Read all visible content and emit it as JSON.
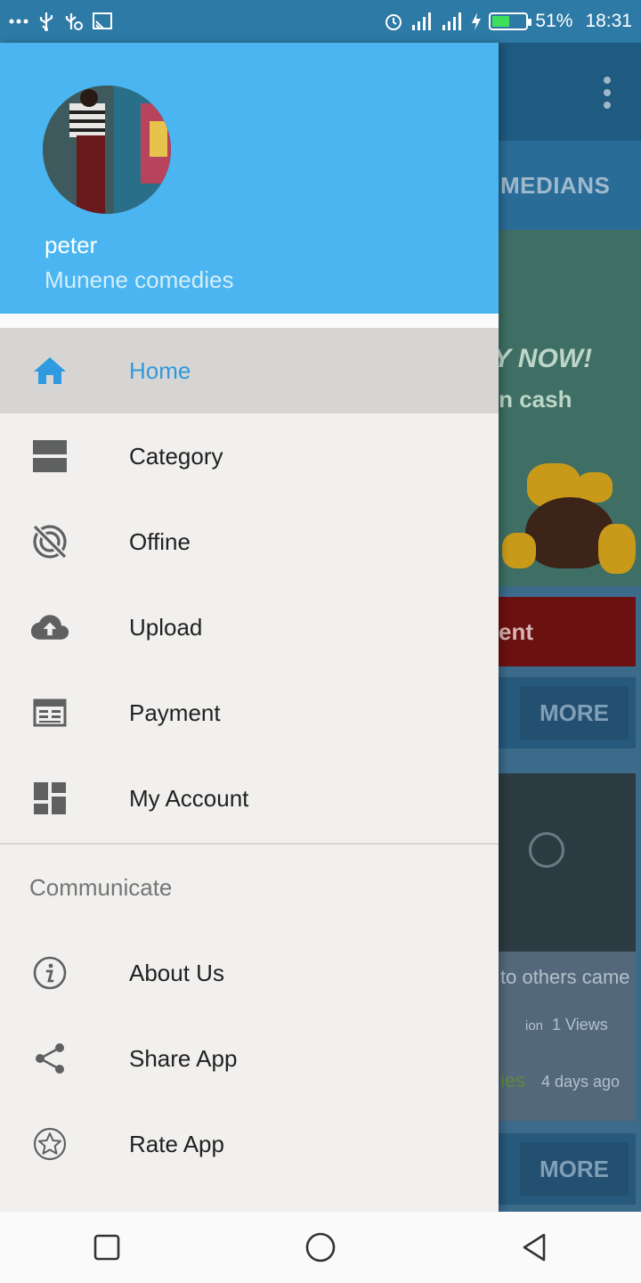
{
  "status_bar": {
    "battery": "51%",
    "time": "18:31",
    "battery_level": 0.51
  },
  "drawer": {
    "header": {
      "name": "peter",
      "subtitle": "Munene comedies"
    },
    "items": [
      {
        "label": "Home",
        "icon": "home-icon",
        "active": true
      },
      {
        "label": "Category",
        "icon": "category-icon"
      },
      {
        "label": "Offine",
        "icon": "offline-icon"
      },
      {
        "label": "Upload",
        "icon": "cloud-upload-icon"
      },
      {
        "label": "Payment",
        "icon": "payment-icon"
      },
      {
        "label": "My Account",
        "icon": "dashboard-icon"
      }
    ],
    "section_title": "Communicate",
    "communicate_items": [
      {
        "label": "About Us",
        "icon": "info-icon"
      },
      {
        "label": "Share App",
        "icon": "share-icon"
      },
      {
        "label": "Rate App",
        "icon": "star-icon"
      }
    ]
  },
  "background": {
    "tab_label": "MEDIANS",
    "banner_line1": "Y NOW!",
    "banner_line2": "rn cash",
    "red_button": "ent",
    "more_label": "MORE",
    "card_title": "to others came",
    "card_views": "1 Views",
    "card_tag_small": "ion",
    "card_tag_green": "ies",
    "card_time": "4 days ago"
  },
  "colors": {
    "drawer_header": "#4ab5f0",
    "active_text": "#2f9ae0",
    "status_bar": "#2e7aa6"
  }
}
